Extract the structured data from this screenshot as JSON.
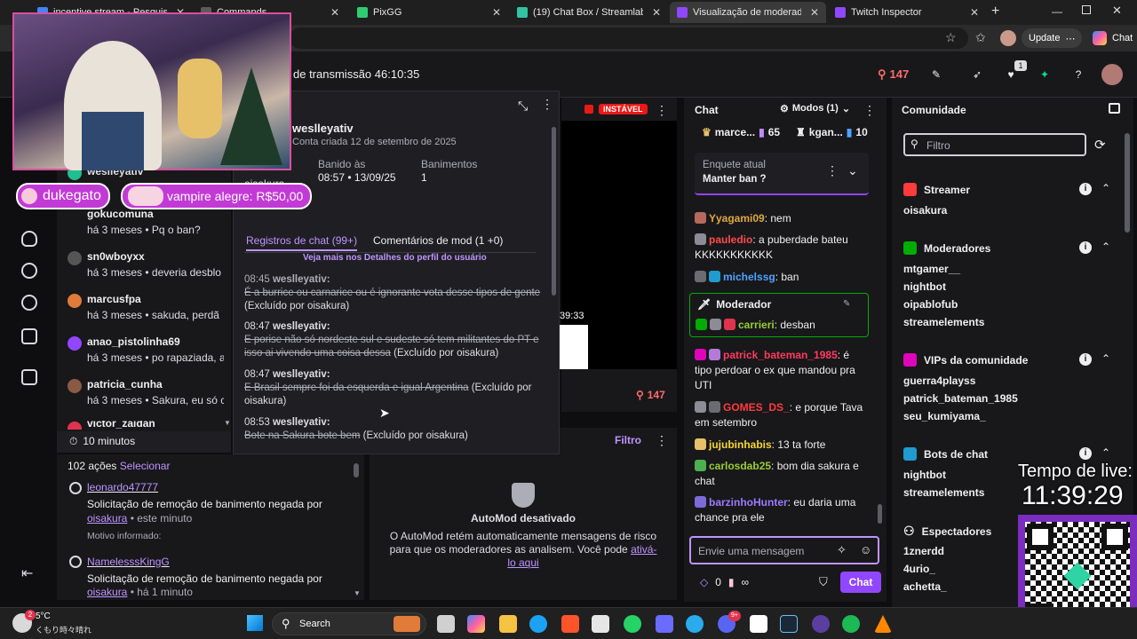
{
  "browser": {
    "tabs": [
      {
        "label": "incentive stream - Pesquisa Go",
        "active": false
      },
      {
        "label": "Commands",
        "active": false
      },
      {
        "label": "PixGG",
        "active": false
      },
      {
        "label": "(19) Chat Box / Streamlabs",
        "active": false
      },
      {
        "label": "Visualização de moderadores",
        "active": true
      },
      {
        "label": "Twitch Inspector",
        "active": false
      }
    ],
    "update_label": "Update",
    "chat_label": "Chat"
  },
  "overlay": {
    "user_badge": "dukegato",
    "donation": "vampire alegre: R$50,00",
    "timer_label": "Tempo de live:",
    "timer_value": "11:39:29"
  },
  "header": {
    "stream_time": "de transmissão 46:10:35",
    "viewer_count": "147"
  },
  "user_list": [
    {
      "name": "weslleyativ",
      "meta": "",
      "color": "#bf94ff"
    },
    {
      "name": "gokucomuna",
      "meta": "há 3 meses • Pq o ban?",
      "color": "#efeff1"
    },
    {
      "name": "sn0wboyxx",
      "meta": "há 3 meses • deveria desblo",
      "color": "#efeff1"
    },
    {
      "name": "marcusfpa",
      "meta": "há 3 meses • sakuda, perdã",
      "color": "#efeff1"
    },
    {
      "name": "anao_pistolinha69",
      "meta": "há 3 meses • po rapaziada, a",
      "color": "#efeff1"
    },
    {
      "name": "patricia_cunha",
      "meta": "há 3 meses • Sakura, eu só c",
      "color": "#efeff1"
    },
    {
      "name": "victor_zaidan",
      "meta": "",
      "color": "#efeff1"
    }
  ],
  "filter_time": "10 minutos",
  "actions": {
    "count": "102 ações",
    "select": "Selecionar",
    "items": [
      {
        "user": "leonardo47777",
        "text": "Solicitação de remoção de banimento negada por",
        "by": "oisakura",
        "when": "• este minuto",
        "reason": "Motivo informado:"
      },
      {
        "user": "NamelesssKingG",
        "text": "Solicitação de remoção de banimento negada por",
        "by": "oisakura",
        "when": "• há 1 minuto"
      }
    ]
  },
  "usercard": {
    "username": "weslleyativ",
    "created": "Conta criada 12 de setembro de 2025",
    "banned_by_label": "oisakura",
    "banned_at_label": "Banido às",
    "banned_at_value": "08:57 • 13/09/25",
    "bans_label": "Banimentos",
    "bans_value": "1",
    "tab_logs": "Registros de chat (99+)",
    "tab_comments": "Comentários de mod (1 +0)",
    "profile_link": "Veja mais nos Detalhes do perfil do usuário",
    "logs": [
      {
        "time": "08:45",
        "user": "weslleyativ:",
        "msg": "É a burrice ou carnarice ou é ignorante vota desse tipos de gente",
        "note": "(Excluído por oisakura)"
      },
      {
        "time": "08:47",
        "user": "weslleyativ:",
        "msg": "E porise não só nordeste sul e sudeste só tem militantes do PT e isso ai vivendo uma coisa dessa",
        "note": "(Excluído por oisakura)"
      },
      {
        "time": "08:47",
        "user": "weslleyativ:",
        "msg": "E Brasil sempre foi da esquerda e igual Argentina",
        "note": "(Excluído por oisakura)"
      },
      {
        "time": "08:53",
        "user": "weslleyativ:",
        "msg": "Bote na Sakura bote bem",
        "note": "(Excluído por oisakura)"
      }
    ]
  },
  "stream_preview": {
    "unstable": "INSTÁVEL",
    "viewers": "147",
    "side_time": "39:33"
  },
  "automod": {
    "filter": "Filtro",
    "title": "AutoMod desativado",
    "body": "O AutoMod retém automaticamente mensagens de risco para que os moderadores as analisem. Você pode",
    "link": "ativá-lo aqui"
  },
  "chat": {
    "title": "Chat",
    "modes": "Modos (1)",
    "top_bar": [
      {
        "name": "marce...",
        "count": "65"
      },
      {
        "name": "kgan...",
        "count": "10"
      }
    ],
    "poll_label": "Enquete atual",
    "poll_question": "Manter ban ?",
    "messages": [
      {
        "user": "Yyagami09",
        "color": "#e0a83f",
        "text": ": nem"
      },
      {
        "user": "pauledio",
        "color": "#ff4b4b",
        "text": ": a puberdade bateu KKKKKKKKKKK"
      },
      {
        "user": "michelssg",
        "color": "#4fa3ff",
        "text": ": ban"
      },
      {
        "user": "patrick_bateman_1985",
        "color": "#ff3b5c",
        "text": ": é tipo perdoar o ex que mandou pra UTI"
      },
      {
        "user": "GOMES_DS_",
        "color": "#ff3b3b",
        "text": ": e porque Tava em setembro"
      },
      {
        "user": "jujubinhabis",
        "color": "#f7d633",
        "text": ": 13 ta forte"
      },
      {
        "user": "carlosdab25",
        "color": "#9acd32",
        "text": ": bom dia sakura e chat"
      },
      {
        "user": "barzinhoHunter",
        "color": "#9b7bff",
        "text": ": eu daria uma chance pra ele"
      }
    ],
    "mod_box_title": "Moderador",
    "mod_box_user": "carrieri",
    "mod_box_text": ": desban",
    "input_placeholder": "Envie uma mensagem",
    "points": "0",
    "infinite": "∞",
    "send": "Chat"
  },
  "community": {
    "title": "Comunidade",
    "filter_placeholder": "Filtro",
    "groups": [
      {
        "title": "Streamer",
        "color": "#ff3b3b",
        "users": [
          "oisakura"
        ]
      },
      {
        "title": "Moderadores",
        "color": "#00ad03",
        "users": [
          "mtgamer__",
          "nightbot",
          "oipablofub",
          "streamelements"
        ]
      },
      {
        "title": "VIPs da comunidade",
        "color": "#e005b9",
        "users": [
          "guerra4playss",
          "patrick_bateman_1985",
          "seu_kumiyama_"
        ]
      },
      {
        "title": "Bots de chat",
        "color": "#1f9bcf",
        "users": [
          "nightbot",
          "streamelements"
        ]
      },
      {
        "title": "Espectadores",
        "color": "#efeff1",
        "users": [
          "1znerdd",
          "4urio_",
          "achetta_"
        ]
      }
    ]
  },
  "taskbar": {
    "weather_temp": "5°C",
    "weather_desc": "くもり時々晴れ",
    "weather_badge": "2",
    "search": "Search",
    "discord_badge": "9+"
  }
}
